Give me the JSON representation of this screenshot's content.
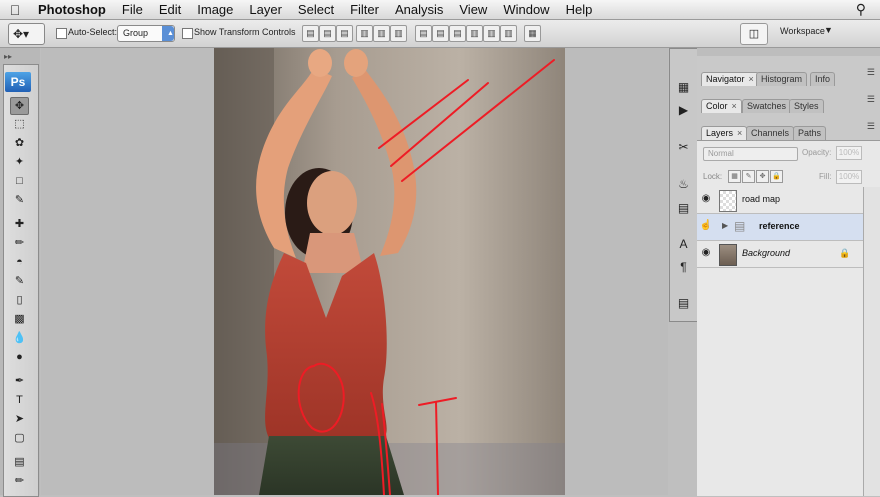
{
  "menubar": {
    "apple": "",
    "app": "Photoshop",
    "items": [
      "File",
      "Edit",
      "Image",
      "Layer",
      "Select",
      "Filter",
      "Analysis",
      "View",
      "Window",
      "Help"
    ]
  },
  "options": {
    "auto_select": "Auto-Select:",
    "group_value": "Group",
    "show_transform": "Show Transform Controls",
    "workspace": "Workspace"
  },
  "toolbox": {
    "logo": "Ps"
  },
  "panels": {
    "group1": [
      "Navigator",
      "Histogram",
      "Info"
    ],
    "group2": [
      "Color",
      "Swatches",
      "Styles"
    ],
    "group3": [
      "Layers",
      "Channels",
      "Paths"
    ],
    "blend_mode": "Normal",
    "opacity_label": "Opacity:",
    "opacity_value": "100%",
    "lock_label": "Lock:",
    "fill_label": "Fill:",
    "fill_value": "100%",
    "layers": [
      {
        "name": "road map"
      },
      {
        "name": "reference"
      },
      {
        "name": "Background"
      }
    ]
  },
  "colors": {
    "annotation_red": "#ee1c25",
    "selected_layer": "#d5dff0",
    "ps_blue": "#2f7dd3"
  }
}
